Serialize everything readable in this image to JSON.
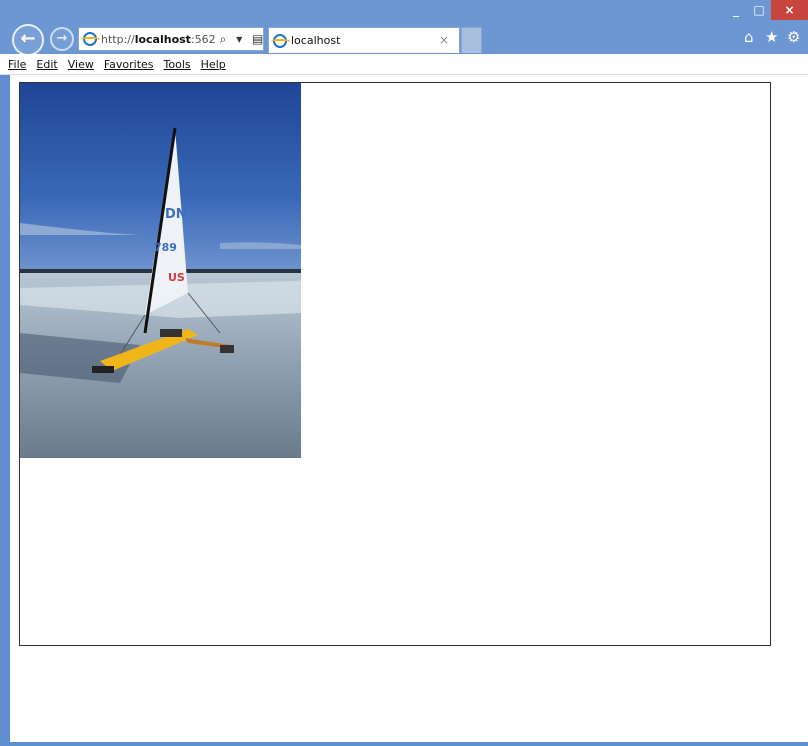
{
  "window": {
    "controls": {
      "minimize": "_",
      "maximize": "□",
      "close": "×"
    }
  },
  "nav": {
    "back_symbol": "←",
    "forward_symbol": "→"
  },
  "address": {
    "url_prefix": "http://",
    "url_host": "localhost",
    "url_port": ":562",
    "tools": "⌕ ▾ ▤ ↻"
  },
  "tab": {
    "title": "localhost",
    "close": "×"
  },
  "toolbar": {
    "home": "⌂",
    "favorites": "★",
    "settings": "⚙"
  },
  "menu": {
    "items": [
      "File",
      "Edit",
      "View",
      "Favorites",
      "Tools",
      "Help"
    ]
  },
  "colors": {
    "frame": "#6d97d3",
    "close_button": "#c7443f",
    "sky": "#2f59a8",
    "ice": "#a8b7c6",
    "hull": "#f1b51c"
  },
  "image": {
    "description_icon": "ice-boat-photo"
  }
}
